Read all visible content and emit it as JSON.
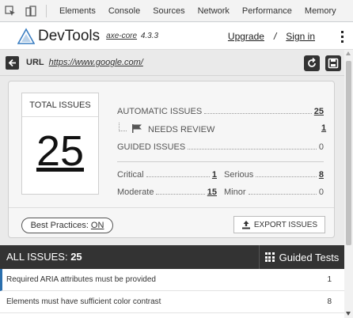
{
  "devtools_tabs": [
    "Elements",
    "Console",
    "Sources",
    "Network",
    "Performance",
    "Memory"
  ],
  "header": {
    "title": "DevTools",
    "core_label": "axe-core",
    "version": "4.3.3",
    "upgrade": "Upgrade",
    "slash": "/",
    "signin": "Sign in"
  },
  "url": {
    "label": "URL",
    "value": "https://www.google.com/"
  },
  "summary": {
    "total_label": "TOTAL ISSUES",
    "total": "25",
    "automatic_label": "AUTOMATIC ISSUES",
    "automatic": "25",
    "needs_review_label": "NEEDS REVIEW",
    "needs_review": "1",
    "guided_label": "GUIDED ISSUES",
    "guided": "0",
    "critical_label": "Critical",
    "critical": "1",
    "serious_label": "Serious",
    "serious": "8",
    "moderate_label": "Moderate",
    "moderate": "15",
    "minor_label": "Minor",
    "minor": "0",
    "best_practices_label": "Best Practices:",
    "best_practices_value": "ON",
    "export_label": "EXPORT ISSUES"
  },
  "issues_bar": {
    "title_prefix": "ALL ISSUES:",
    "count": "25",
    "guided_tests": "Guided Tests"
  },
  "issues": [
    {
      "text": "Required ARIA attributes must be provided",
      "count": "1"
    },
    {
      "text": "Elements must have sufficient color contrast",
      "count": "8"
    }
  ],
  "colors": {
    "accent": "#2b6fad",
    "dark_bar": "#333333",
    "logo_blue": "#3a7ec2"
  }
}
